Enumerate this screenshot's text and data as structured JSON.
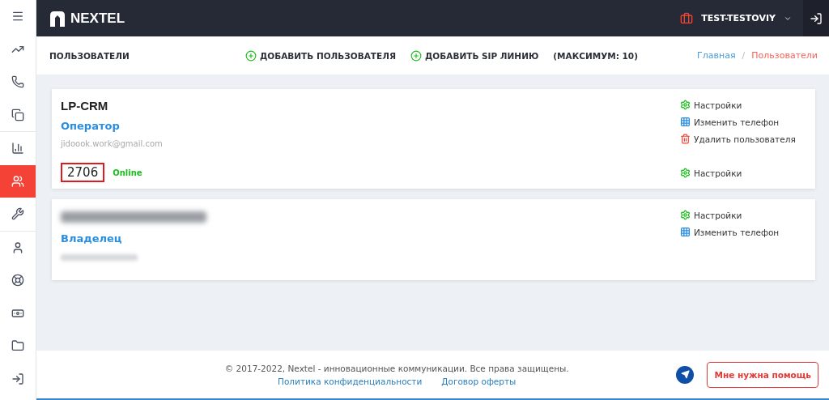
{
  "sidebar": {
    "groups": [
      [
        {
          "selected": false
        },
        {
          "selected": false
        },
        {
          "selected": false
        },
        {
          "selected": false
        }
      ],
      [
        {
          "selected": false
        },
        {
          "selected": true
        },
        {
          "selected": false
        }
      ],
      [
        {
          "selected": false
        },
        {
          "selected": false
        },
        {
          "selected": false
        },
        {
          "selected": false
        },
        {
          "selected": false
        }
      ]
    ]
  },
  "topbar": {
    "logo": "NEXTEL",
    "account": "TEST-TESTOVIY"
  },
  "header": {
    "title": "ПОЛЬЗОВАТЕЛИ",
    "actions": [
      "ДОБАВИТЬ ПОЛЬЗОВАТЕЛЯ",
      "ДОБАВИТЬ SIP ЛИНИЮ"
    ],
    "limit": "(МАКСИМУМ: 10)",
    "breadcrumb_separator": "/",
    "breadcrumbs": [
      {
        "label": "Главная",
        "selected": false
      },
      {
        "label": "Пользователи",
        "selected": true
      }
    ]
  },
  "users": [
    {
      "name": "LP-CRM",
      "redacted": false,
      "role": "Оператор",
      "email": "jidoook.work@gmail.com",
      "actions": [
        {
          "kind": "settings",
          "label": "Настройки"
        },
        {
          "kind": "phone",
          "label": "Изменить телефон"
        },
        {
          "kind": "delete",
          "label": "Удалить пользователя"
        }
      ],
      "extension": {
        "number": "2706",
        "highlighted": true,
        "status": "Online",
        "action": {
          "kind": "settings",
          "label": "Настройки"
        }
      }
    },
    {
      "redacted": true,
      "role": "Владелец",
      "actions": [
        {
          "kind": "settings",
          "label": "Настройки"
        },
        {
          "kind": "phone",
          "label": "Изменить телефон"
        }
      ]
    }
  ],
  "footer": {
    "copyright": "© 2017-2022, Nextel - инновационные коммуникации. Все права защищены.",
    "links": [
      "Политика конфиденциальности",
      "Договор оферты"
    ],
    "help": "Мне нужна помощь"
  }
}
